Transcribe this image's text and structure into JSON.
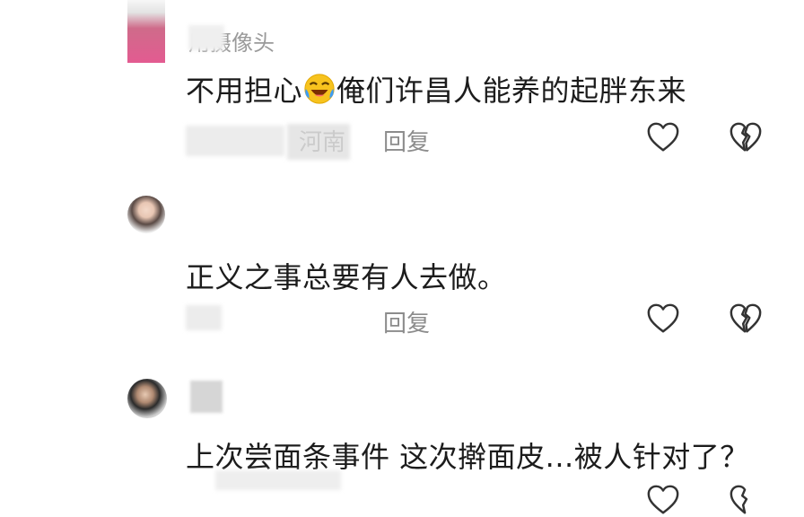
{
  "comments": [
    {
      "username": "用摄像头",
      "text_before": "不用担心",
      "emoji": "rofl-emoji",
      "text_after": "俺们许昌人能养的起胖东来",
      "location": "河南",
      "reply_label": "回复"
    },
    {
      "text": "正义之事总要有人去做。",
      "reply_label": "回复"
    },
    {
      "text": "上次尝面条事件  这次擀面皮...被人针对了？"
    }
  ],
  "icons": {
    "like": "heart-outline-icon",
    "dislike": "broken-heart-icon"
  }
}
